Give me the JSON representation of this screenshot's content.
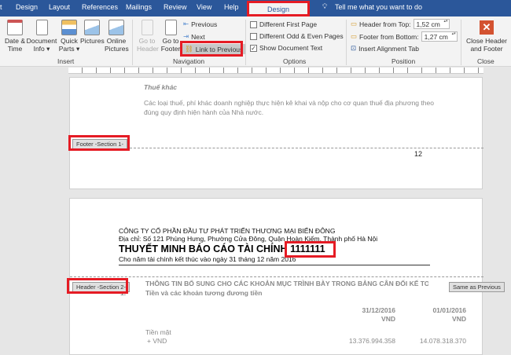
{
  "tabs": [
    "t",
    "Design",
    "Layout",
    "References",
    "Mailings",
    "Review",
    "View",
    "Help"
  ],
  "context_tab": "Design",
  "tell_me": "Tell me what you want to do",
  "insert_group": {
    "label": "Insert",
    "buttons": [
      "Date &\nTime",
      "Document\nInfo ▾",
      "Quick\nParts ▾",
      "Pictures",
      "Online\nPictures"
    ]
  },
  "navigation_group": {
    "label": "Navigation",
    "go_to_header": "Go to\nHeader",
    "go_to_footer": "Go to\nFooter",
    "previous": "Previous",
    "next": "Next",
    "link_to_previous": "Link to Previous"
  },
  "options_group": {
    "label": "Options",
    "items": [
      {
        "label": "Different First Page",
        "checked": false
      },
      {
        "label": "Different Odd & Even Pages",
        "checked": false
      },
      {
        "label": "Show Document Text",
        "checked": true
      }
    ]
  },
  "position_group": {
    "label": "Position",
    "header_from_top_label": "Header from Top:",
    "header_from_top": "1,52 cm",
    "footer_from_bottom_label": "Footer from Bottom:",
    "footer_from_bottom": "1,27 cm",
    "insert_alignment_tab": "Insert Alignment Tab"
  },
  "close_group": {
    "label": "Close",
    "button": "Close Header\nand Footer"
  },
  "page1": {
    "heading": "Thuế khác",
    "body": "Các loại thuế, phí khác doanh nghiệp thực hiện kê khai và nộp cho cơ quan thuế địa phương theo đúng quy định hiện hành của Nhà nước.",
    "footer_label": "Footer -Section 1-",
    "page_number": "12"
  },
  "page2": {
    "company": "CÔNG TY CỔ PHẦN ĐẦU TƯ PHÁT TRIỂN THƯƠNG MẠI BIỂN ĐÔNG",
    "address": "Địa chỉ: Số 121 Phùng Hưng, Phường Cửa Đông, Quận Hoàn Kiếm, Thành phố Hà Nội",
    "title": "THUYẾT MINH BÁO CÁO TÀI CHÍNH",
    "title_suffix": "1111111",
    "subtitle": "Cho năm tài chính kết thúc vào ngày 31 tháng 12 năm 2016",
    "header_label": "Header -Section 2-",
    "same_as_previous": "Same as Previous",
    "section_heading": "THÔNG TIN BỔ SUNG CHO CÁC KHOẢN MỤC TRÌNH BÀY TRONG BẢNG CÂN ĐỐI KẾ TOÁN",
    "item_number": "1.",
    "item_heading": "Tiền và các khoản tương đương tiền",
    "col1_date": "31/12/2016",
    "col2_date": "01/01/2016",
    "currency": "VND",
    "row_label": "Tiền mặt",
    "sub_label": "+ VND",
    "val1": "13.376.994.358",
    "val2": "14.078.318.370"
  }
}
